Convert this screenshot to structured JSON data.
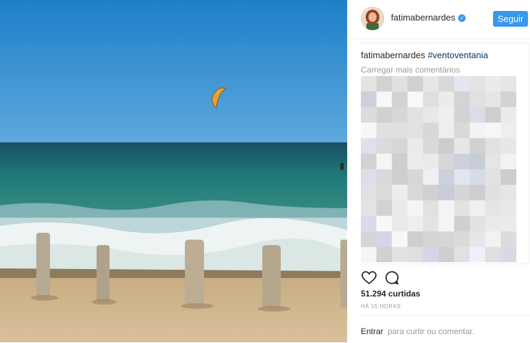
{
  "post": {
    "username": "fatimabernardes",
    "verified_icon": "verified-badge-icon",
    "follow_label": "Seguir",
    "caption_user": "fatimabernardes",
    "caption_hashtag": "#ventoventania",
    "load_more": "Carregar mais comentários",
    "likes": "51.294 curtidas",
    "time": "HÁ 15 HORAS",
    "login_link": "Entrar",
    "login_rest": "para curtir ou comentar."
  },
  "icons": {
    "like": "heart-icon",
    "comment": "comment-bubble-icon"
  },
  "colors": {
    "accent": "#3897f0",
    "text": "#262626",
    "muted": "#999999",
    "hashtag": "#003569"
  }
}
